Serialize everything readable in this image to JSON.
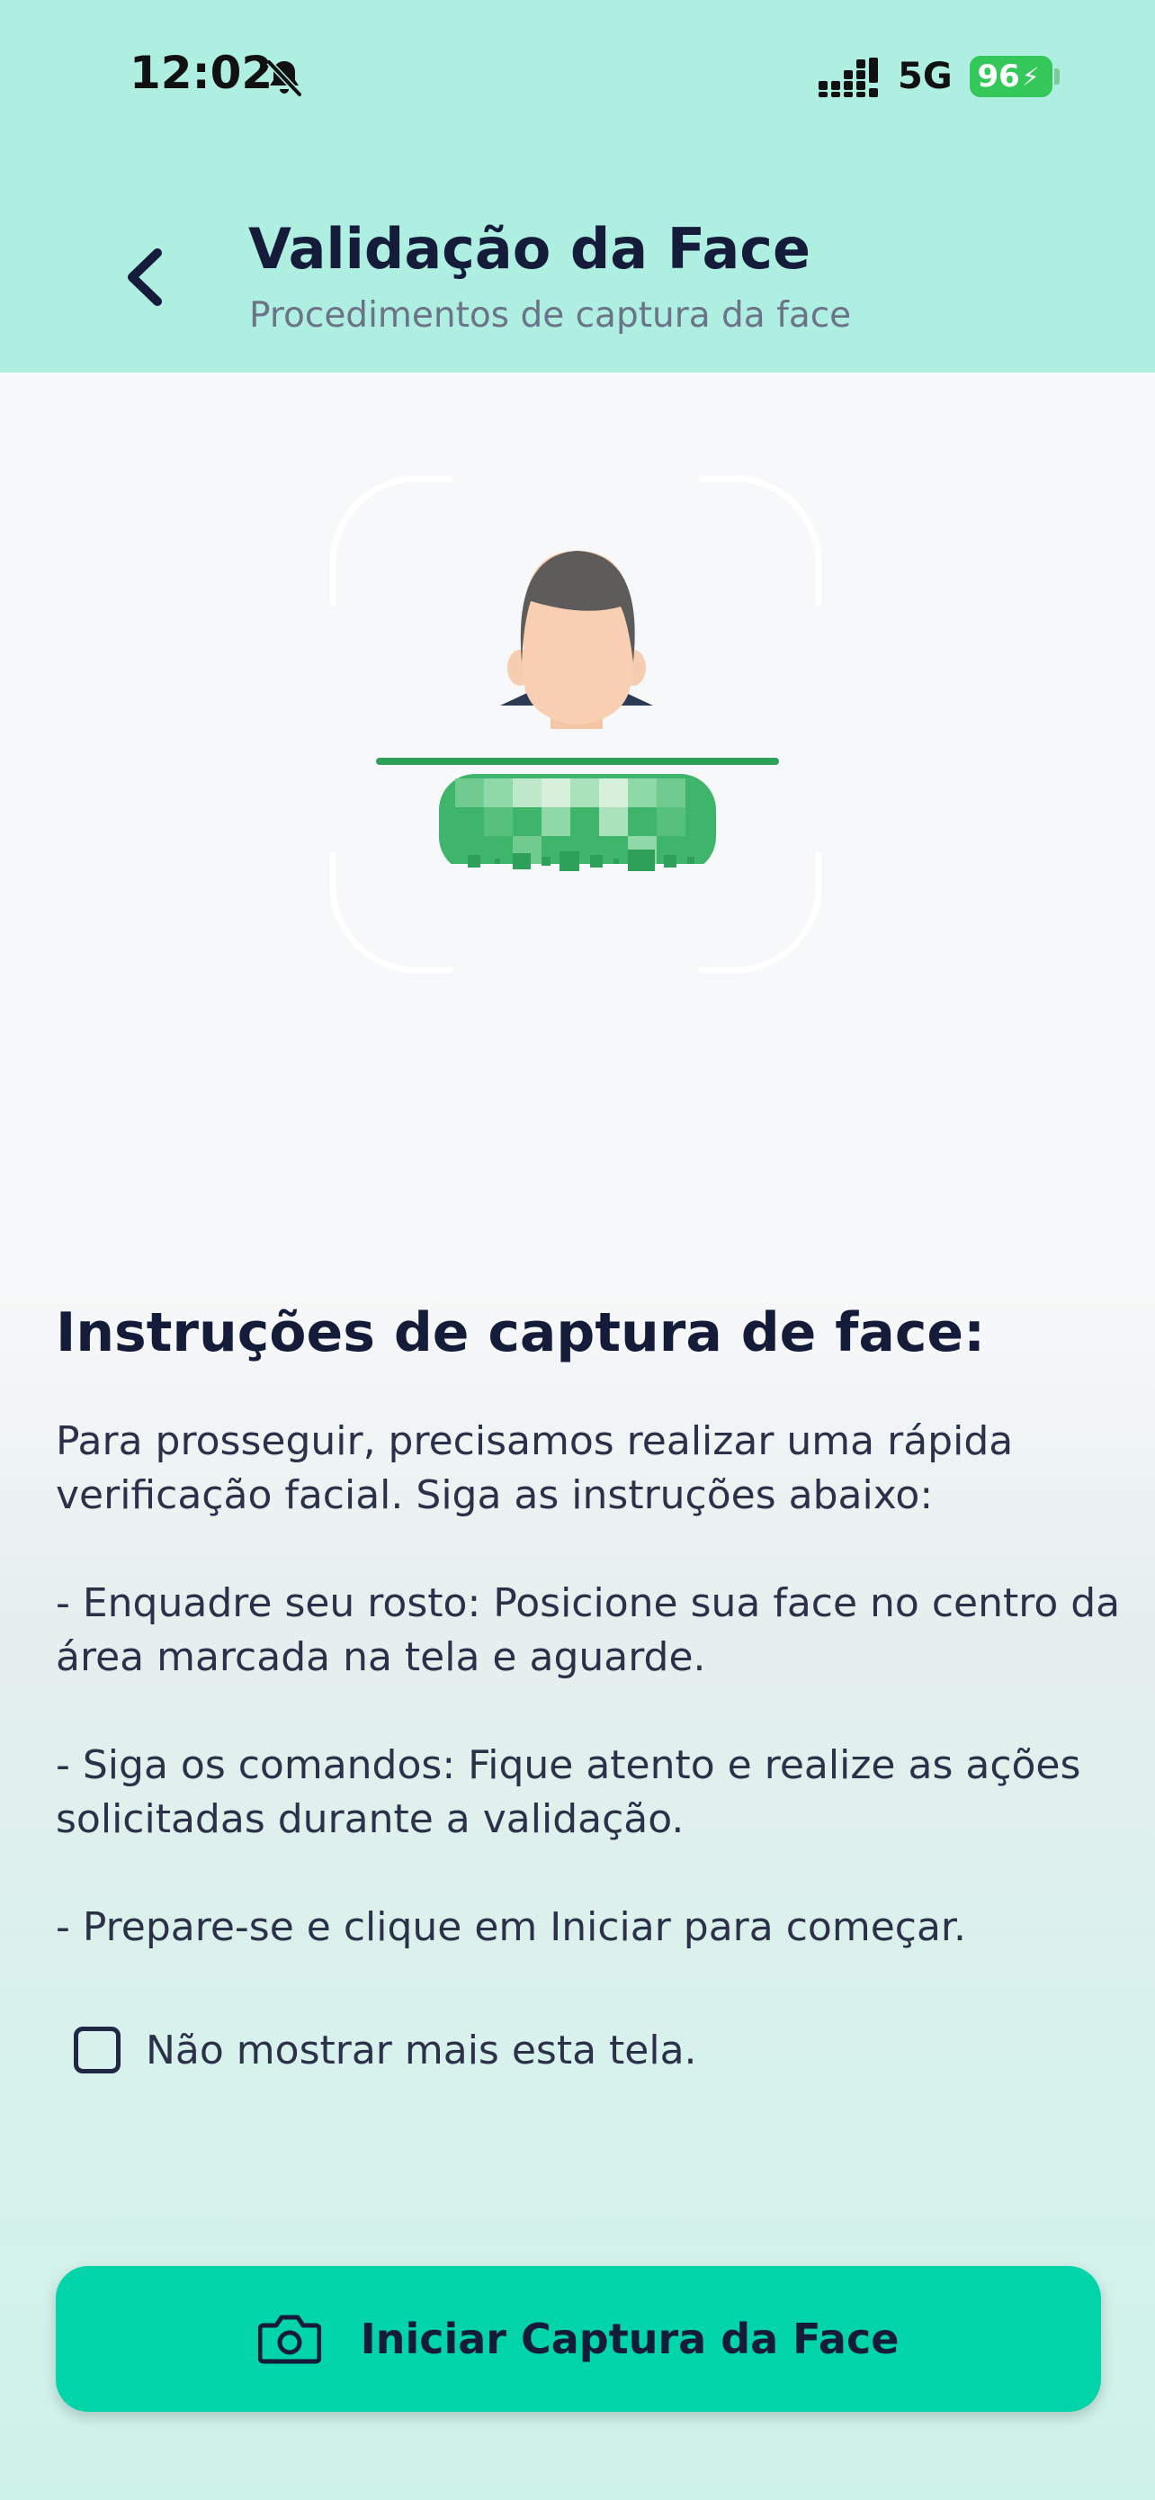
{
  "status_bar": {
    "time": "12:02",
    "network": "5G",
    "battery": "96"
  },
  "header": {
    "title": "Validação da Face",
    "subtitle": "Procedimentos de captura da face"
  },
  "instructions": {
    "title": "Instruções de captura de face:",
    "paragraphs": [
      "Para prosseguir, precisamos realizar uma rápida verificação facial. Siga as instruções abaixo:",
      "- Enquadre seu rosto: Posicione sua face no centro da área marcada na tela e aguarde.",
      "- Siga os comandos: Fique atento e realize as ações solicitadas durante a validação.",
      "- Prepare-se e clique em Iniciar para começar."
    ]
  },
  "checkbox": {
    "label": "Não mostrar mais esta tela.",
    "checked": false
  },
  "button": {
    "label": "Iniciar Captura da Face",
    "icon": "camera-icon"
  },
  "colors": {
    "header_bg": "#aeefe2",
    "accent": "#00d4a8",
    "battery": "#34c759",
    "scan_line": "#2fa05a"
  }
}
